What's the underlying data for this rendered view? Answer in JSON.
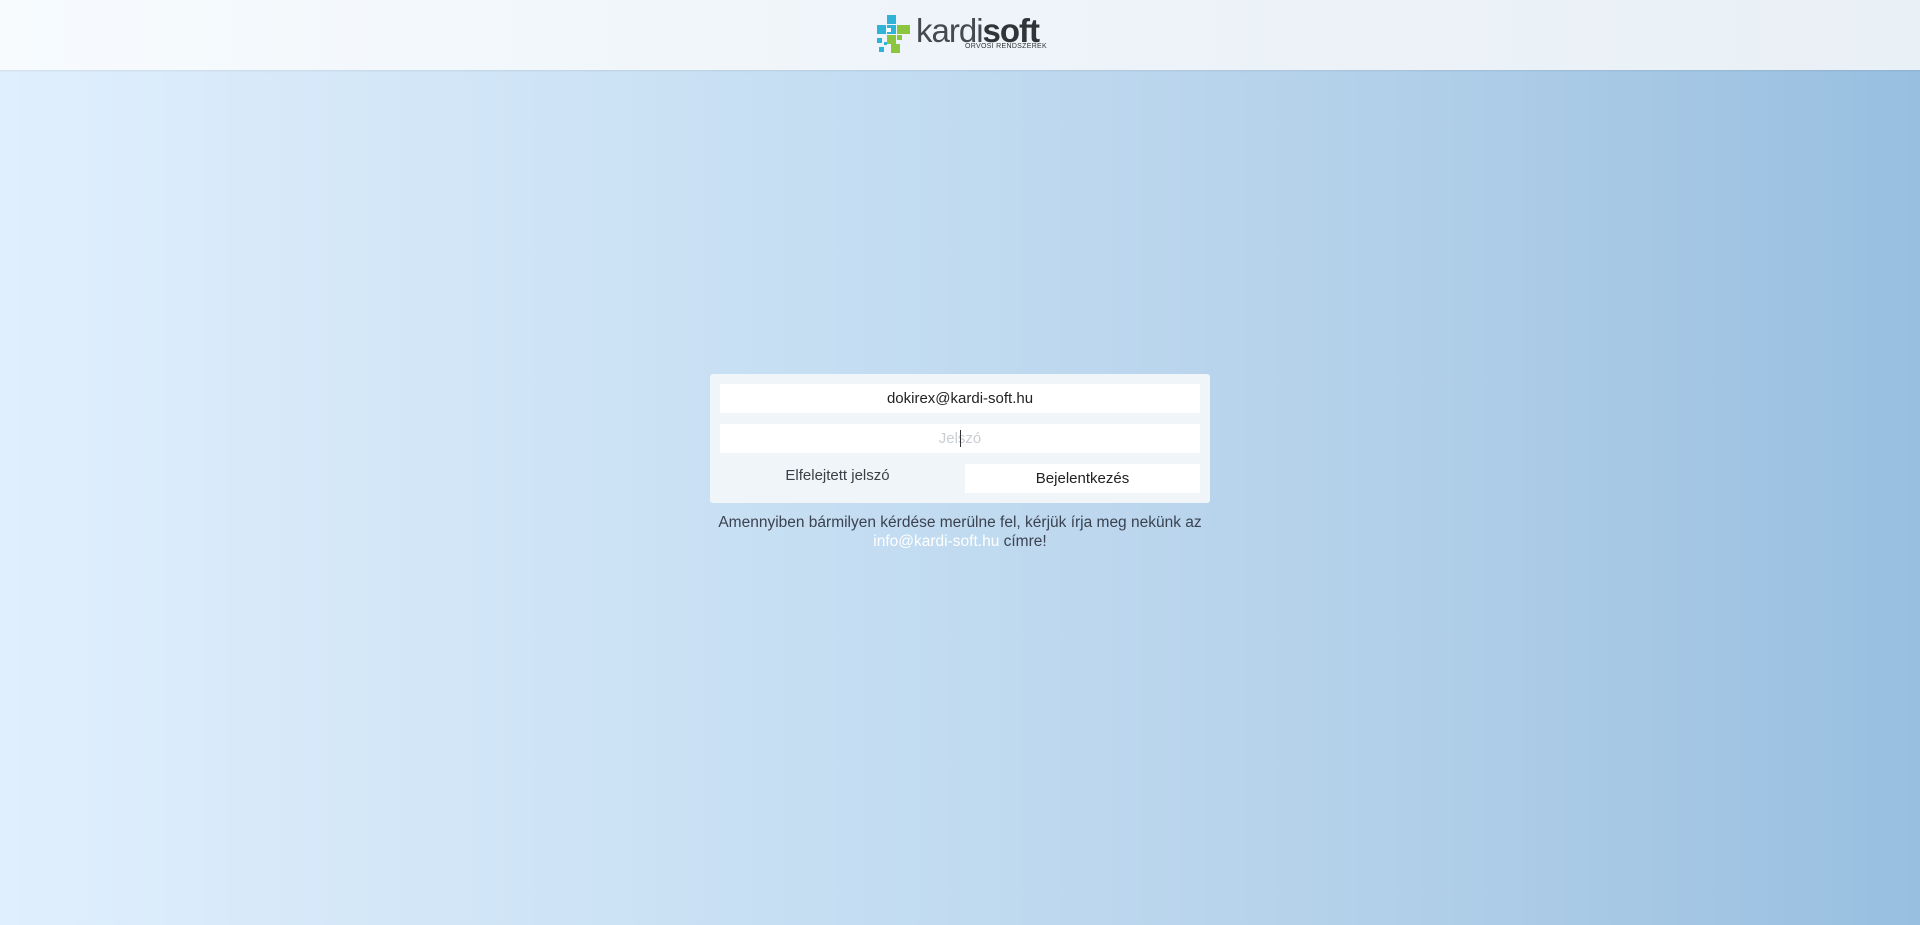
{
  "brand": {
    "name_light": "kardi",
    "name_bold": "soft",
    "tagline": "ORVOSI RENDSZEREK",
    "colors": {
      "teal": "#2fb4d8",
      "green": "#8cc63f",
      "dark": "#2f3437"
    }
  },
  "login": {
    "email_value": "dokirex@kardi-soft.hu",
    "password_placeholder": "Jelszó",
    "forgot_label": "Elfelejtett jelszó",
    "submit_label": "Bejelentkezés"
  },
  "help": {
    "text_before": "Amennyiben bármilyen kérdése merülne fel, kérjük írja meg nekünk az",
    "email": "info@kardi-soft.hu",
    "text_after": "címre!"
  }
}
